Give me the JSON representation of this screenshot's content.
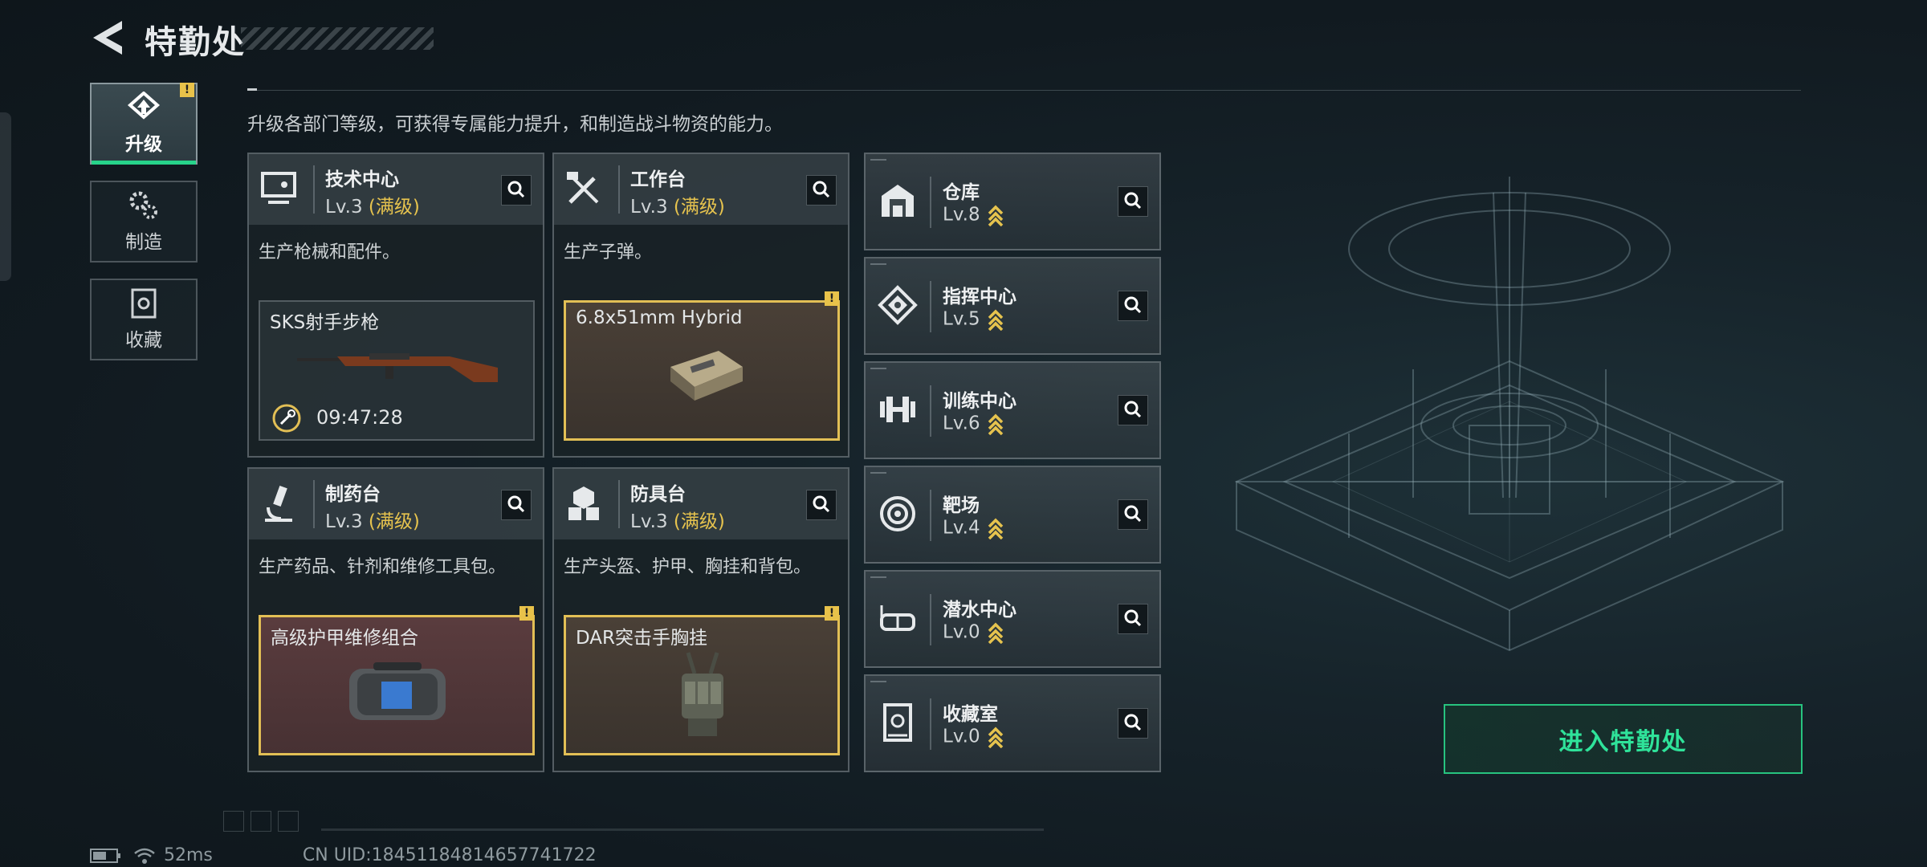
{
  "header": {
    "title": "特勤处"
  },
  "description": "升级各部门等级，可获得专属能力提升，和制造战斗物资的能力。",
  "tabs": [
    {
      "label": "升级",
      "icon": "upgrade-icon",
      "active": true,
      "alert": "!"
    },
    {
      "label": "制造",
      "icon": "gears-icon",
      "active": false
    },
    {
      "label": "收藏",
      "icon": "collection-icon",
      "active": false
    }
  ],
  "cards": [
    {
      "name": "技术中心",
      "level": "Lv.3",
      "max": "(满级)",
      "desc": "生产枪械和配件。",
      "icon": "computer-icon",
      "slot": {
        "item": "SKS射手步枪",
        "timer": "09:47:28"
      }
    },
    {
      "name": "工作台",
      "level": "Lv.3",
      "max": "(满级)",
      "desc": "生产子弹。",
      "icon": "tools-icon",
      "slot": {
        "item": "6.8x51mm Hybrid",
        "alert": "!"
      }
    },
    {
      "name": "制药台",
      "level": "Lv.3",
      "max": "(满级)",
      "desc": "生产药品、针剂和维修工具包。",
      "icon": "microscope-icon",
      "slot": {
        "item": "高级护甲维修组合",
        "alert": "!"
      }
    },
    {
      "name": "防具台",
      "level": "Lv.3",
      "max": "(满级)",
      "desc": "生产头盔、护甲、胸挂和背包。",
      "icon": "armor-icon",
      "slot": {
        "item": "DAR突击手胸挂",
        "alert": "!"
      }
    }
  ],
  "departments": [
    {
      "name": "仓库",
      "level": "Lv.8",
      "icon": "warehouse-icon"
    },
    {
      "name": "指挥中心",
      "level": "Lv.5",
      "icon": "command-icon"
    },
    {
      "name": "训练中心",
      "level": "Lv.6",
      "icon": "dumbbell-icon"
    },
    {
      "name": "靶场",
      "level": "Lv.4",
      "icon": "target-icon"
    },
    {
      "name": "潜水中心",
      "level": "Lv.0",
      "icon": "diving-mask-icon"
    },
    {
      "name": "收藏室",
      "level": "Lv.0",
      "icon": "collection-room-icon"
    }
  ],
  "enter_button": "进入特勤处",
  "status": {
    "ping": "52ms",
    "uid": "CN UID:18451184814657741722"
  },
  "colors": {
    "accent_green": "#27d38a",
    "gold": "#e6c34e"
  }
}
